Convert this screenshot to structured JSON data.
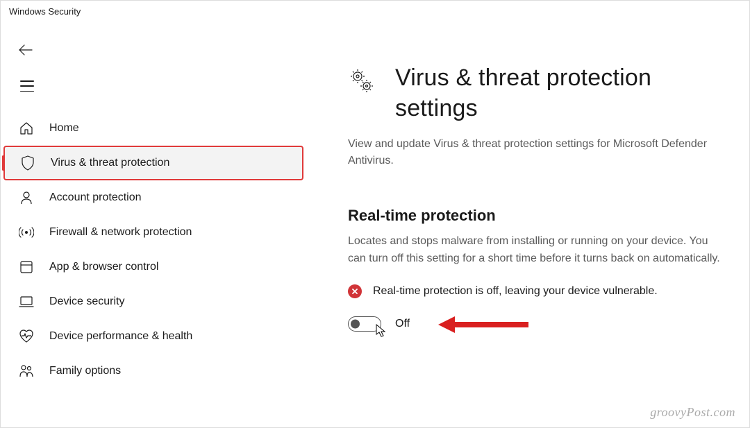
{
  "window": {
    "title": "Windows Security"
  },
  "sidebar": {
    "items": [
      {
        "label": "Home",
        "icon": "home-icon"
      },
      {
        "label": "Virus & threat protection",
        "icon": "shield-icon",
        "selected": true
      },
      {
        "label": "Account protection",
        "icon": "person-icon"
      },
      {
        "label": "Firewall & network protection",
        "icon": "antenna-icon"
      },
      {
        "label": "App & browser control",
        "icon": "app-icon"
      },
      {
        "label": "Device security",
        "icon": "laptop-icon"
      },
      {
        "label": "Device performance & health",
        "icon": "heart-icon"
      },
      {
        "label": "Family options",
        "icon": "family-icon"
      }
    ]
  },
  "page": {
    "title": "Virus & threat protection settings",
    "description": "View and update Virus & threat protection settings for Microsoft Defender Antivirus."
  },
  "section": {
    "title": "Real-time protection",
    "description": "Locates and stops malware from installing or running on your device. You can turn off this setting for a short time before it turns back on automatically.",
    "warning": "Real-time protection is off, leaving your device vulnerable.",
    "toggle_state": "Off"
  },
  "watermark": "groovyPost.com"
}
